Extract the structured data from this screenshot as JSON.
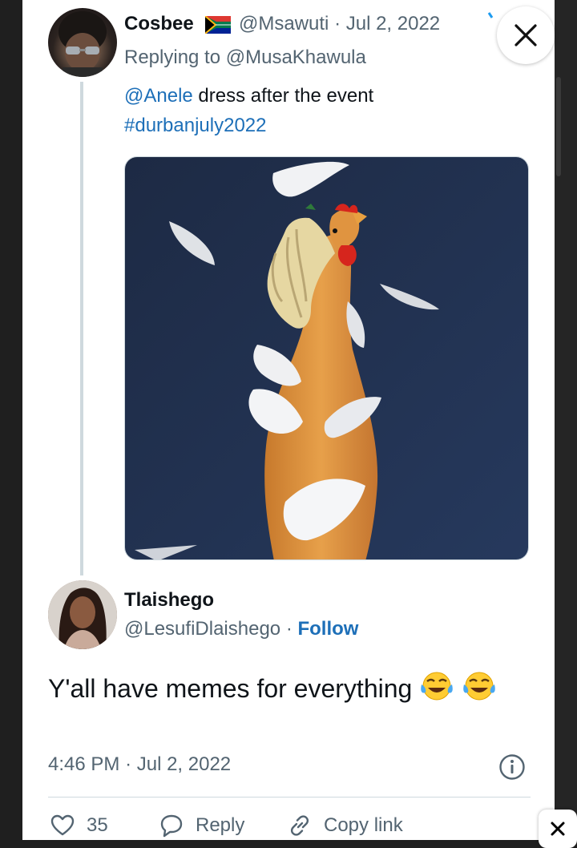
{
  "tweet1": {
    "display_name": "Cosbee",
    "handle": "@Msawuti",
    "date": "Jul 2, 2022",
    "replying_prefix": "Replying to",
    "replying_to": "@MusaKhawula",
    "mention": "@Anele",
    "text": "dress after the event",
    "hashtag": "#durbanjuly2022"
  },
  "tweet2": {
    "display_name": "Tlaishego",
    "handle": "@LesufiDlaishego",
    "follow_label": "Follow",
    "text": "Y'all have memes for everything",
    "time": "4:46 PM",
    "date": "Jul 2, 2022"
  },
  "actions": {
    "like_count": "35",
    "reply_label": "Reply",
    "copy_link_label": "Copy link"
  },
  "icons": [
    "close-icon",
    "south-africa-flag-icon",
    "face-with-tears-of-joy-icon",
    "info-icon",
    "heart-icon",
    "reply-bubble-icon",
    "link-icon"
  ],
  "colors": {
    "link": "#1d6fb8",
    "secondary_text": "#536471",
    "primary_text": "#0f1419",
    "divider": "#cfd9de"
  }
}
